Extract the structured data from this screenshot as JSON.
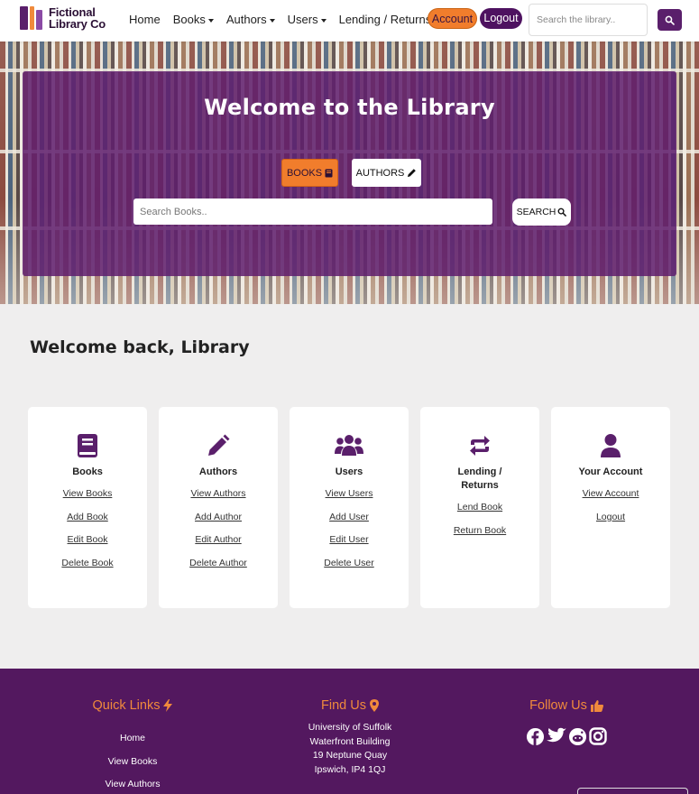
{
  "brand": {
    "line1": "Fictional",
    "line2": "Library Co"
  },
  "nav": {
    "links": [
      "Home",
      "Books",
      "Authors",
      "Users",
      "Lending / Returns"
    ],
    "account_label": "Account",
    "logout_label": "Logout",
    "search_placeholder": "Search the library.."
  },
  "hero": {
    "title": "Welcome to the Library",
    "books_toggle": "BOOKS",
    "authors_toggle": "AUTHORS",
    "search_placeholder": "Search Books..",
    "search_button": "SEARCH"
  },
  "welcome": "Welcome back, Library",
  "cards": [
    {
      "title": "Books",
      "icon": "book-icon",
      "links": [
        "View Books",
        "Add Book",
        "Edit Book",
        "Delete Book"
      ]
    },
    {
      "title": "Authors",
      "icon": "pencil-icon",
      "links": [
        "View Authors",
        "Add Author",
        "Edit Author",
        "Delete Author"
      ]
    },
    {
      "title": "Users",
      "icon": "users-icon",
      "links": [
        "View Users",
        "Add User",
        "Edit User",
        "Delete User"
      ]
    },
    {
      "title_line1": "Lending /",
      "title_line2": "Returns",
      "icon": "repeat-icon",
      "links": [
        "Lend Book",
        "Return Book"
      ]
    },
    {
      "title": "Your Account",
      "icon": "user-icon",
      "links": [
        "View Account",
        "Logout"
      ]
    }
  ],
  "footer": {
    "quick_links": {
      "heading": "Quick Links",
      "items": [
        "Home",
        "View Books",
        "View Authors"
      ]
    },
    "find_us": {
      "heading": "Find Us",
      "address": [
        "University of Suffolk",
        "Waterfront Building",
        "19 Neptune Quay",
        "Ipswich, IP4 1QJ"
      ]
    },
    "follow_us": {
      "heading": "Follow Us",
      "networks": [
        "facebook-icon",
        "twitter-icon",
        "reddit-icon",
        "instagram-icon"
      ]
    }
  },
  "colors": {
    "primary": "#5a1f6b",
    "accent": "#f17d2c",
    "footer": "#53185f"
  }
}
